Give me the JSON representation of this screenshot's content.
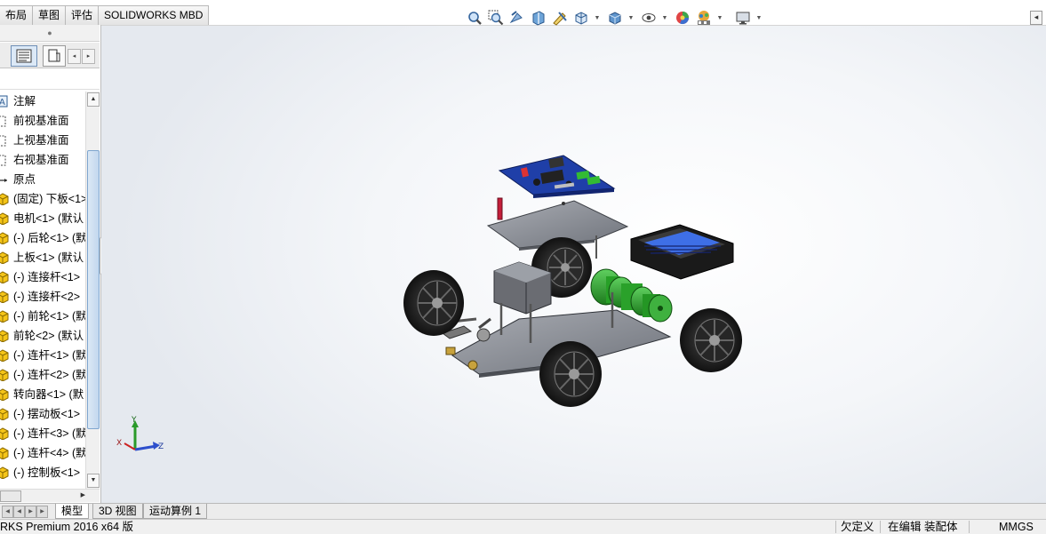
{
  "command_tabs": [
    "布局",
    "草图",
    "评估",
    "SOLIDWORKS MBD"
  ],
  "feature_tree": {
    "items": [
      {
        "label": "注解",
        "icon": "annotation-icon"
      },
      {
        "label": "前视基准面",
        "icon": "plane-icon"
      },
      {
        "label": "上视基准面",
        "icon": "plane-icon"
      },
      {
        "label": "右视基准面",
        "icon": "plane-icon"
      },
      {
        "label": "原点",
        "icon": "origin-icon"
      },
      {
        "label": "(固定) 下板<1>",
        "icon": "part-icon"
      },
      {
        "label": "电机<1> (默认",
        "icon": "part-icon"
      },
      {
        "label": "(-) 后轮<1> (默",
        "icon": "part-icon"
      },
      {
        "label": "上板<1> (默认",
        "icon": "part-icon"
      },
      {
        "label": "(-) 连接杆<1>",
        "icon": "part-icon"
      },
      {
        "label": "(-) 连接杆<2>",
        "icon": "part-icon"
      },
      {
        "label": "(-) 前轮<1> (默",
        "icon": "part-icon"
      },
      {
        "label": "前轮<2> (默认",
        "icon": "part-icon"
      },
      {
        "label": "(-) 连杆<1> (默",
        "icon": "part-icon"
      },
      {
        "label": "(-) 连杆<2> (默",
        "icon": "part-icon"
      },
      {
        "label": "转向器<1> (默",
        "icon": "part-icon"
      },
      {
        "label": "(-) 摆动板<1>",
        "icon": "part-icon"
      },
      {
        "label": "(-) 连杆<3> (默",
        "icon": "part-icon"
      },
      {
        "label": "(-) 连杆<4> (默",
        "icon": "part-icon"
      },
      {
        "label": "(-) 控制板<1>",
        "icon": "part-icon"
      }
    ]
  },
  "bottom_tabs": [
    "模型",
    "3D 视图",
    "运动算例 1"
  ],
  "status_bar": {
    "app_name": "RKS Premium 2016 x64 版",
    "definition": "欠定义",
    "mode": "在编辑 装配体",
    "units": "MMGS"
  },
  "triad": {
    "x": "X",
    "y": "Y",
    "z": "Z"
  },
  "colors": {
    "accent": "#2c5ea8",
    "pcb": "#1f3fa8",
    "motor": "#2ea02e"
  }
}
